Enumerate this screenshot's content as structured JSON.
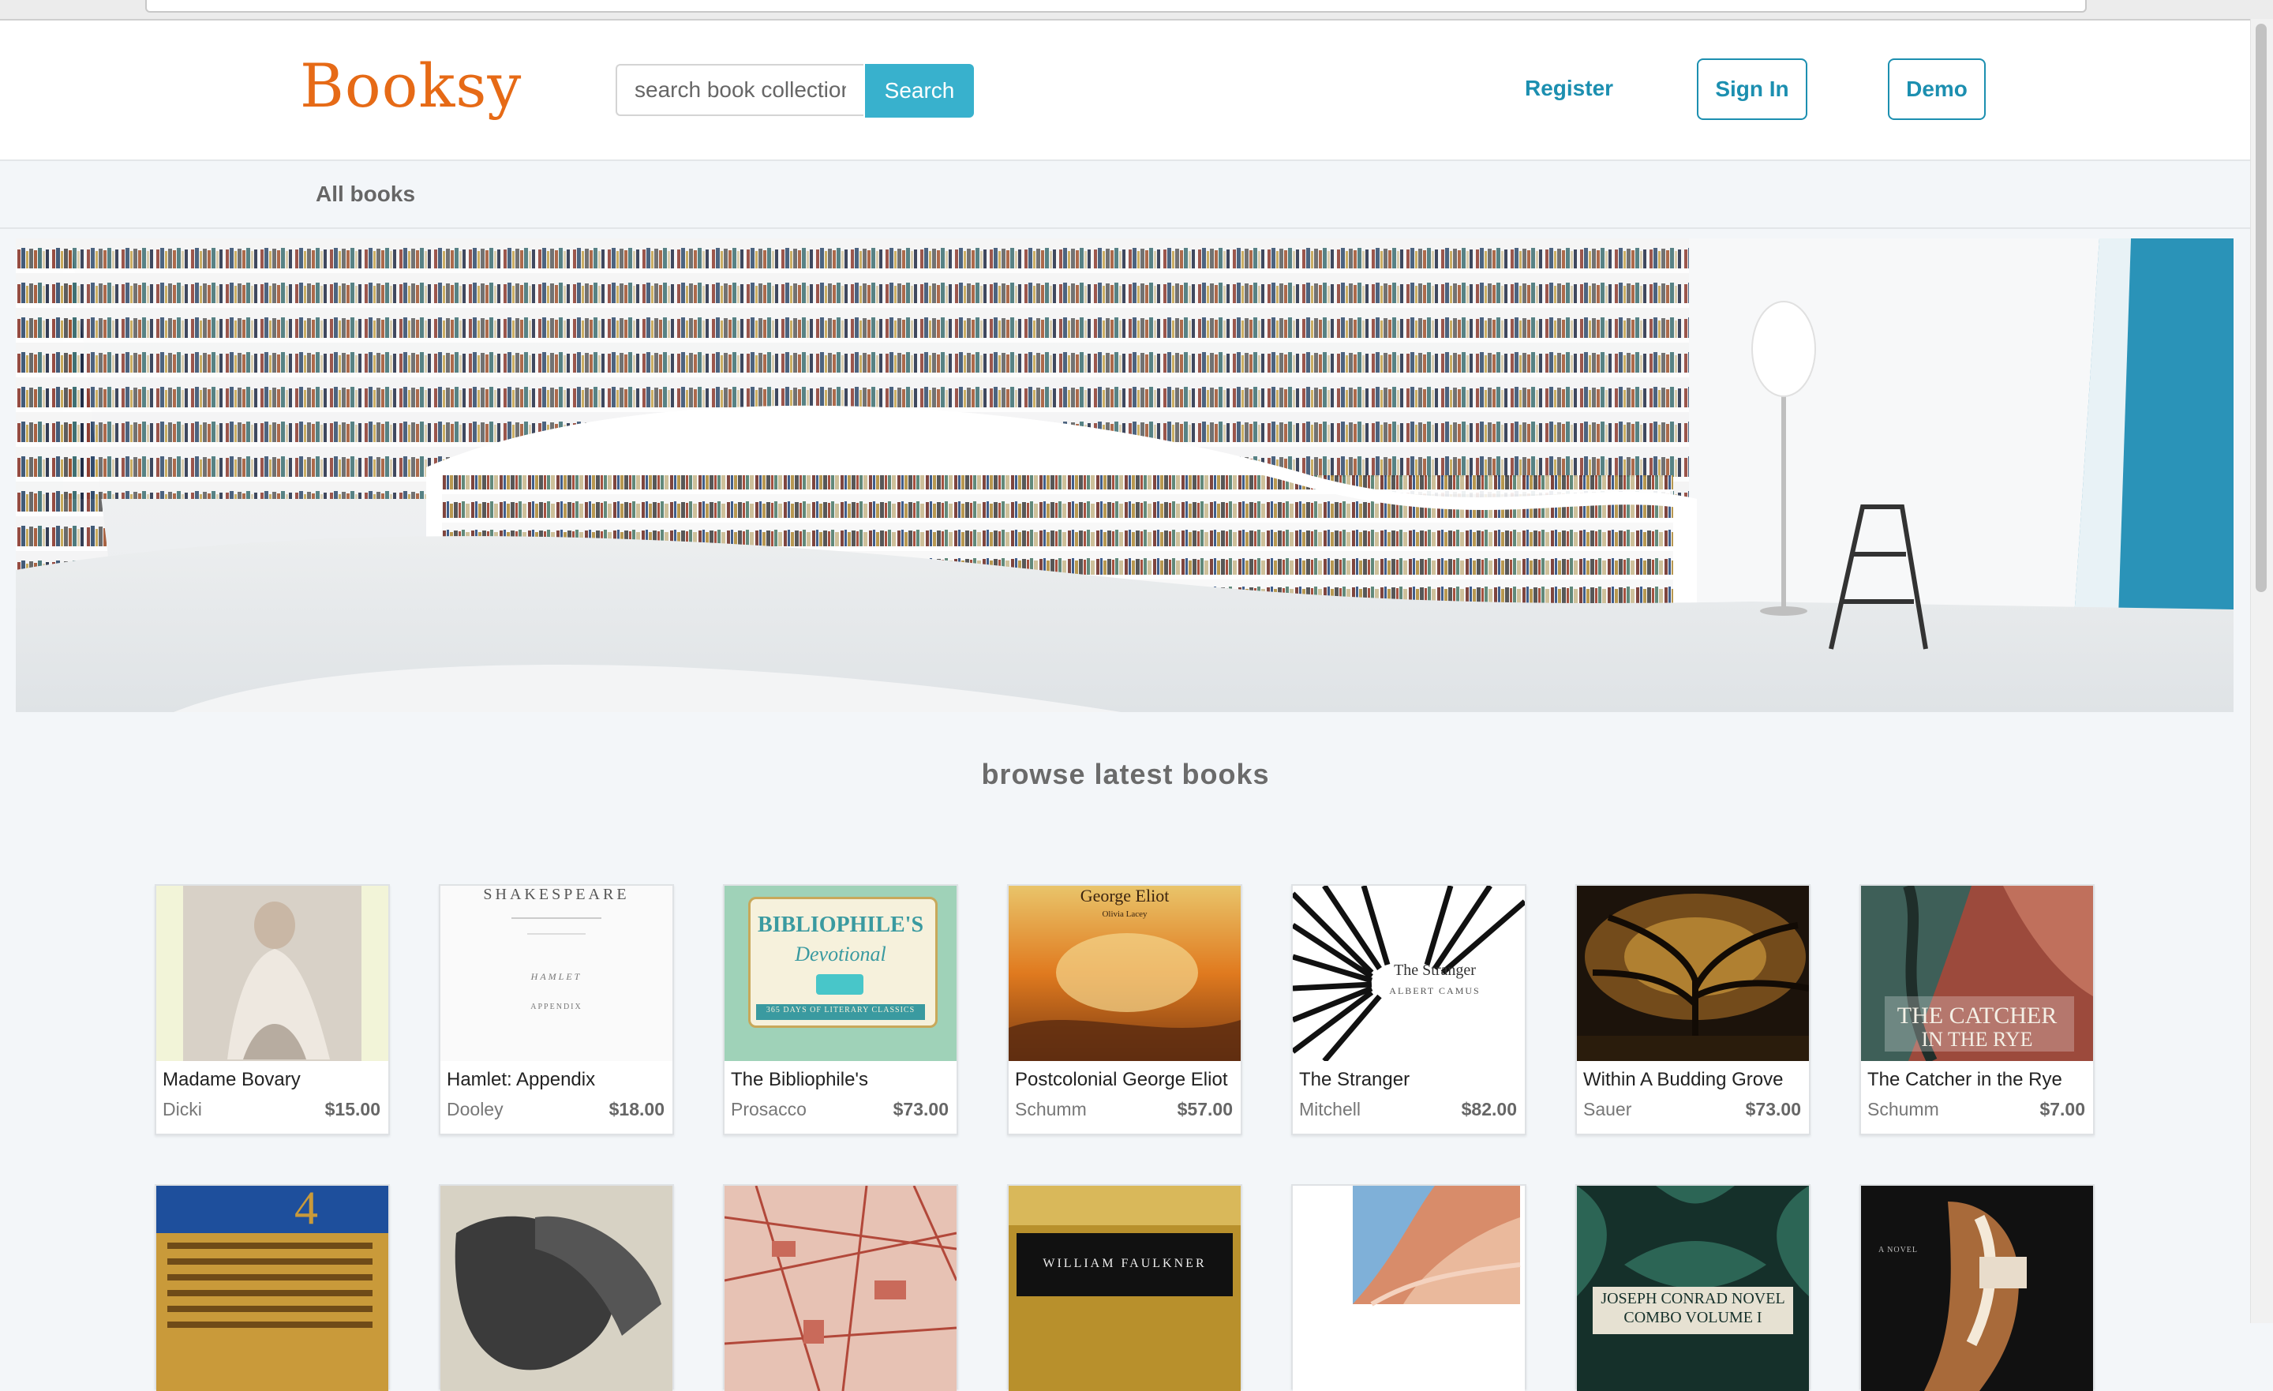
{
  "browser": {
    "url_fragment": ""
  },
  "header": {
    "logo": "Booksy",
    "search_placeholder": "search book collection",
    "search_button": "Search",
    "register": "Register",
    "sign_in": "Sign In",
    "demo": "Demo"
  },
  "subnav": {
    "all_books": "All books"
  },
  "main": {
    "section_title": "browse latest books"
  },
  "books": [
    {
      "title": "Madame Bovary",
      "author": "Dicki",
      "price": "$15.00"
    },
    {
      "title": "Hamlet: Appendix",
      "author": "Dooley",
      "price": "$18.00"
    },
    {
      "title": "The Bibliophile's",
      "author": "Prosacco",
      "price": "$73.00"
    },
    {
      "title": "Postcolonial George Eliot",
      "author": "Schumm",
      "price": "$57.00"
    },
    {
      "title": "The Stranger",
      "author": "Mitchell",
      "price": "$82.00"
    },
    {
      "title": "Within A Budding Grove",
      "author": "Sauer",
      "price": "$73.00"
    },
    {
      "title": "The Catcher in the Rye",
      "author": "Schumm",
      "price": "$7.00"
    }
  ],
  "covers": {
    "hamlet_top": "SHAKESPEARE",
    "hamlet_mid": "HAMLET",
    "hamlet_low": "APPENDIX",
    "biblio_1": "BIBLIOPHILE'S",
    "biblio_2": "Devotional",
    "biblio_3": "365 DAYS OF LITERARY CLASSICS",
    "eliot_1": "George Eliot",
    "eliot_2": "Olivia Lacey",
    "stranger_1": "The Stranger",
    "stranger_2": "ALBERT CAMUS",
    "catcher_1": "THE CATCHER",
    "catcher_2": "IN THE RYE",
    "faulkner": "WILLIAM FAULKNER",
    "conrad_1": "JOSEPH CONRAD NOVEL",
    "conrad_2": "COMBO VOLUME I",
    "novel_tag": "A NOVEL",
    "row2_first": "4"
  },
  "colors": {
    "brand": "#e66a16",
    "accent": "#38b1cd",
    "link": "#1c8fb0",
    "page_bg": "#f3f6f9"
  }
}
